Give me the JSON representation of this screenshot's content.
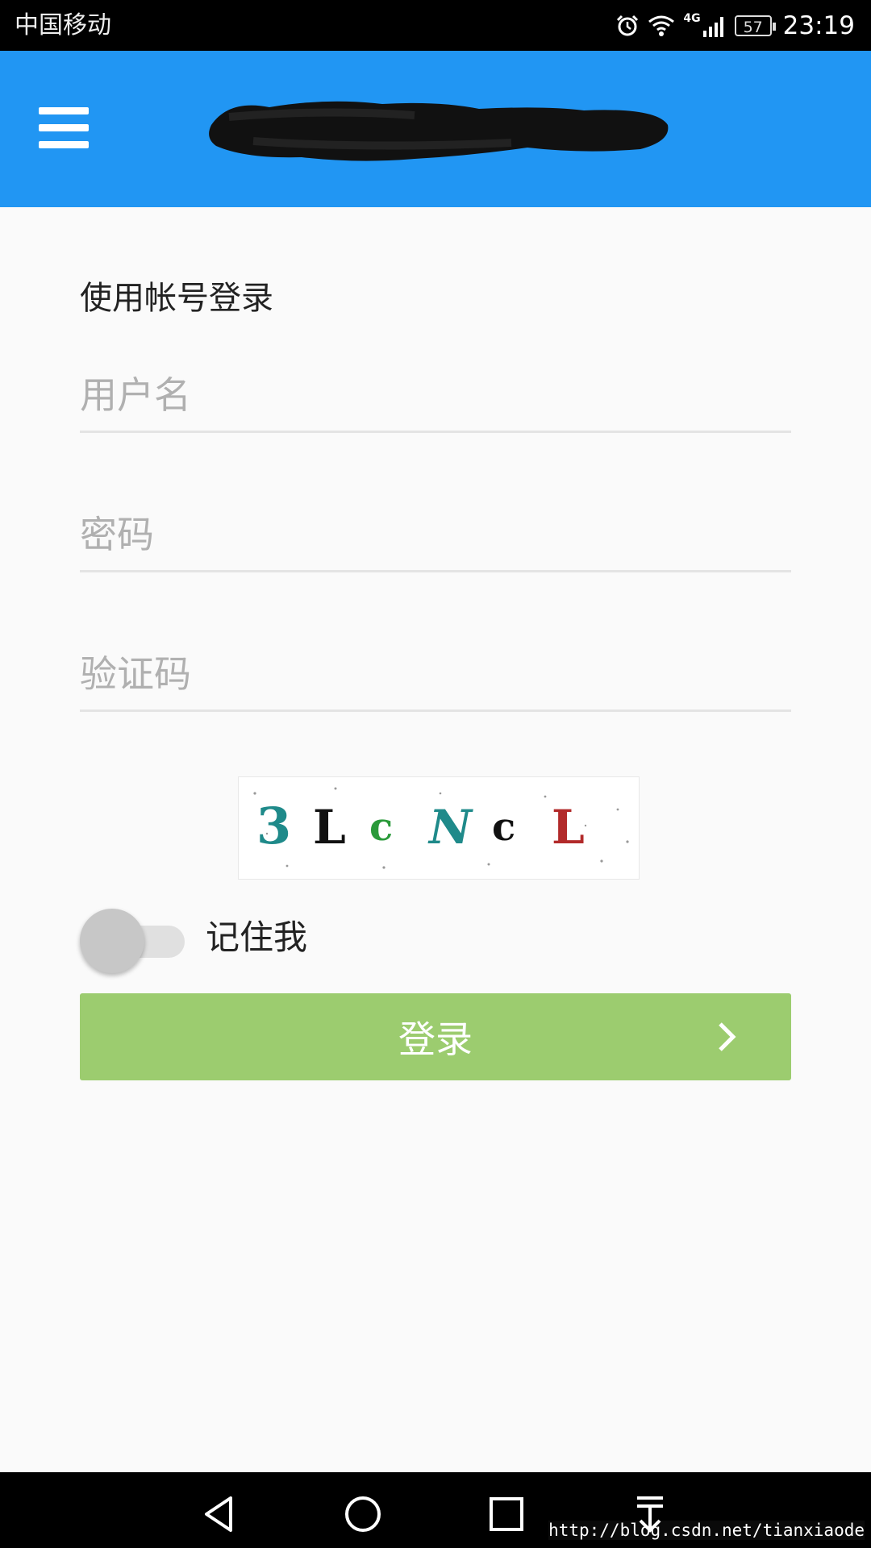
{
  "status_bar": {
    "carrier": "中国移动",
    "network": "4G",
    "battery": "57",
    "time": "23:19"
  },
  "app_bar": {
    "menu_icon": "hamburger-menu-icon",
    "title_redacted": true,
    "background": "#2196f3"
  },
  "login": {
    "title": "使用帐号登录",
    "username_placeholder": "用户名",
    "password_placeholder": "密码",
    "captcha_placeholder": "验证码",
    "captcha_text": [
      "3",
      "L",
      "c",
      "N",
      "c",
      "L"
    ],
    "remember_label": "记住我",
    "remember_on": false,
    "submit_label": "登录",
    "submit_color": "#9ccc6f"
  },
  "nav_bar": {
    "buttons": [
      "back-icon",
      "home-icon",
      "recents-icon",
      "notification-pull-icon"
    ]
  },
  "watermark": "http://blog.csdn.net/tianxiaode"
}
